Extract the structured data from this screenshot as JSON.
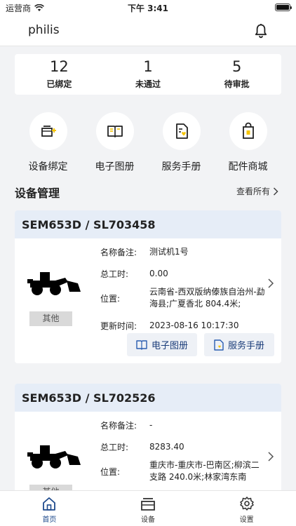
{
  "status_bar": {
    "carrier": "运营商",
    "time": "下午 3:41"
  },
  "header": {
    "username": "philis"
  },
  "stats": [
    {
      "value": "12",
      "label": "已绑定"
    },
    {
      "value": "1",
      "label": "未通过"
    },
    {
      "value": "5",
      "label": "待审批"
    }
  ],
  "quick_actions": [
    {
      "label": "设备绑定",
      "icon": "device-bind-icon"
    },
    {
      "label": "电子图册",
      "icon": "book-icon"
    },
    {
      "label": "服务手册",
      "icon": "service-manual-icon"
    },
    {
      "label": "配件商城",
      "icon": "shopping-bag-icon"
    }
  ],
  "section": {
    "title": "设备管理",
    "view_all": "查看所有"
  },
  "field_labels": {
    "name_note": "名称备注:",
    "total_hours": "总工时:",
    "location": "位置:",
    "updated": "更新时间:"
  },
  "buttons": {
    "ebook": "电子图册",
    "manual": "服务手册"
  },
  "devices": [
    {
      "model": "SEM653D / SL703458",
      "tag": "其他",
      "name_note": "测试机1号",
      "total_hours": "0.00",
      "location": "云南省-西双版纳傣族自治州-勐海县;广夏香北 804.4米;",
      "updated": "2023-08-16 10:17:30"
    },
    {
      "model": "SEM653D / SL702526",
      "tag": "其他",
      "name_note": "-",
      "total_hours": "8283.40",
      "location": "重庆市-重庆市-巴南区;柳滨二支路 240.0米;林家湾东南",
      "updated": ""
    }
  ],
  "tabbar": [
    {
      "label": "首页",
      "icon": "home-icon",
      "active": true
    },
    {
      "label": "设备",
      "icon": "device-icon",
      "active": false
    },
    {
      "label": "设置",
      "icon": "gear-icon",
      "active": false
    }
  ],
  "colors": {
    "accent": "#1e4a8c",
    "card_header": "#e6edf7",
    "background": "#f2f3f5",
    "icon_yellow": "#f5c400"
  }
}
